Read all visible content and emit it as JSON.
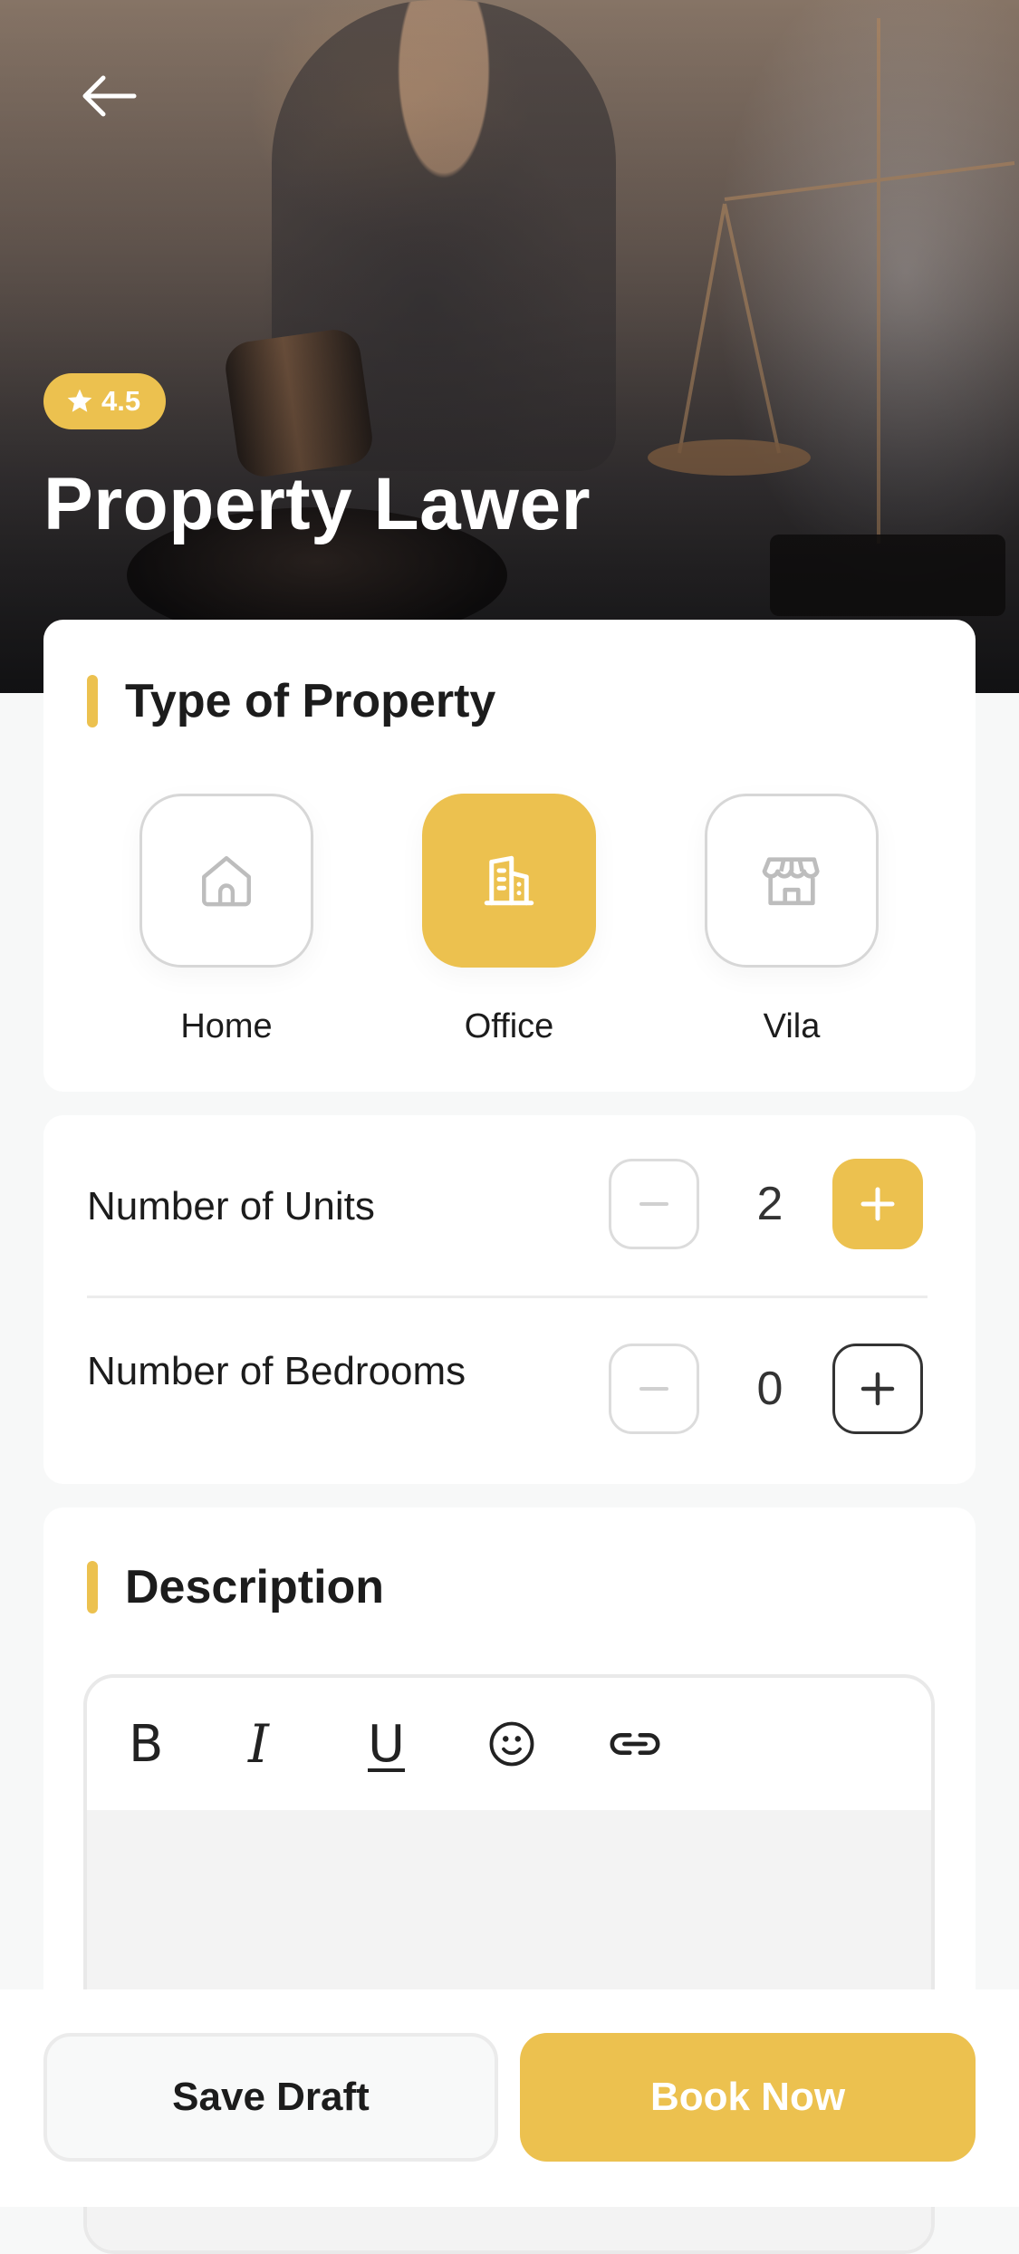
{
  "hero": {
    "title": "Property Lawer",
    "rating": "4.5"
  },
  "icons": {
    "back": "arrow-left-icon",
    "rating": "star-icon",
    "home": "home-icon",
    "office": "building-icon",
    "vila": "store-icon",
    "minus": "minus-icon",
    "plus": "plus-icon",
    "bold": "bold-icon",
    "italic": "italic-icon",
    "underline": "underline-icon",
    "emoji": "smile-icon",
    "link": "link-icon"
  },
  "property_type": {
    "title": "Type of Property",
    "options": [
      {
        "label": "Home",
        "selected": false
      },
      {
        "label": "Office",
        "selected": true
      },
      {
        "label": "Vila",
        "selected": false
      }
    ]
  },
  "counts": {
    "units": {
      "label": "Number of Units",
      "value": "2"
    },
    "bedrooms": {
      "label": "Number of Bedrooms",
      "value": "0"
    }
  },
  "description": {
    "title": "Description",
    "toolbar": {
      "bold": "B",
      "italic": "I",
      "underline": "U"
    },
    "value": ""
  },
  "actions": {
    "save_draft": "Save Draft",
    "book_now": "Book Now"
  },
  "colors": {
    "accent": "#ecc14f",
    "text": "#1c1c1c",
    "background": "#f7f8f8"
  }
}
